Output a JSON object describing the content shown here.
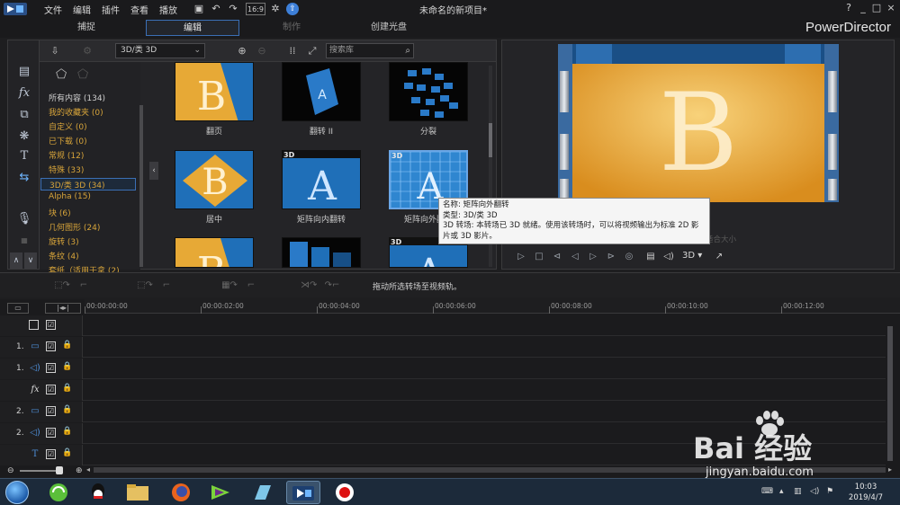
{
  "menu": [
    "文件",
    "编辑",
    "插件",
    "查看",
    "播放"
  ],
  "document_title": "未命名的新项目*",
  "window_controls": [
    "?",
    "_",
    "□",
    "×"
  ],
  "modes": [
    {
      "label": "捕捉",
      "active": false,
      "enabled": true
    },
    {
      "label": "编辑",
      "active": true,
      "enabled": true
    },
    {
      "label": "制作",
      "active": false,
      "enabled": false
    },
    {
      "label": "创建光盘",
      "active": false,
      "enabled": true
    }
  ],
  "brand": "PowerDirector",
  "library": {
    "category_select": "3D/类 3D",
    "search_placeholder": "搜索库",
    "categories": [
      {
        "label": "所有内容 (134)",
        "kind": "all"
      },
      {
        "label": "我的收藏夹 (0)"
      },
      {
        "label": "自定义 (0)"
      },
      {
        "label": "已下载 (0)"
      },
      {
        "label": "常规 (12)"
      },
      {
        "label": "特殊 (33)"
      },
      {
        "label": "3D/类 3D (34)",
        "selected": true
      },
      {
        "label": "Alpha (15)"
      },
      {
        "label": "块 (6)"
      },
      {
        "label": "几何图形 (24)"
      },
      {
        "label": "旋转 (3)"
      },
      {
        "label": "条纹 (4)"
      },
      {
        "label": "套纸（适用于拿 (2)"
      }
    ],
    "transitions": [
      {
        "label": "翻页",
        "is3d": false
      },
      {
        "label": "翻转 II",
        "is3d": false
      },
      {
        "label": "分裂",
        "is3d": false
      },
      {
        "label": "居中",
        "is3d": false
      },
      {
        "label": "矩阵向内翻转",
        "is3d": true
      },
      {
        "label": "矩阵向外翻转",
        "is3d": true,
        "selected": true
      },
      {
        "label": "",
        "is3d": false
      },
      {
        "label": "",
        "is3d": false
      },
      {
        "label": "",
        "is3d": true
      }
    ],
    "badge_3d": "3D"
  },
  "tooltip": {
    "name": "名称: 矩阵向外翻转",
    "type": "类型: 3D/类 3D",
    "desc": "3D 转场: 本转场已 3D 就绪。使用该转场时，可以将视频输出为标准 2D 影片或 3D 影片。"
  },
  "preview": {
    "letter": "B",
    "size_label": "适合大小",
    "mode_3d": "3D"
  },
  "timeline": {
    "hint": "拖动所选转场至视频轨。",
    "ruler": [
      "00:00:00:00",
      "00:00:02:00",
      "00:00:04:00",
      "00:00:06:00",
      "00:00:08:00",
      "00:00:10:00",
      "00:00:12:00"
    ],
    "tracks": [
      {
        "num": "",
        "icon": "",
        "type": "master"
      },
      {
        "num": "1.",
        "icon": "▭",
        "type": "video"
      },
      {
        "num": "1.",
        "icon": "◁)",
        "type": "audio"
      },
      {
        "num": "",
        "icon": "fx",
        "type": "fx"
      },
      {
        "num": "2.",
        "icon": "▭",
        "type": "video"
      },
      {
        "num": "2.",
        "icon": "◁)",
        "type": "audio"
      },
      {
        "num": "",
        "icon": "T",
        "type": "title"
      }
    ],
    "check_mark": "☑"
  },
  "taskbar": {
    "time": "10:03",
    "date": "2019/4/7"
  },
  "watermark": {
    "brand_text": "Bai 经验",
    "url": "jingyan.baidu.com"
  },
  "colors": {
    "accent": "#3b6fb5",
    "category_text": "#d7a43a",
    "thumb_gold": "#e7a936",
    "thumb_blue": "#1f6fb8"
  }
}
